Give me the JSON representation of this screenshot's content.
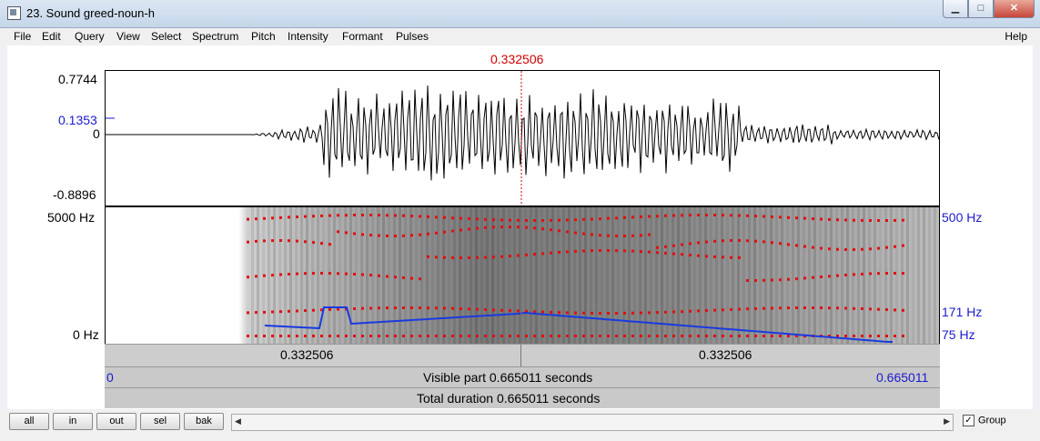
{
  "window": {
    "title": "23. Sound greed-noun-h"
  },
  "icons": {
    "minimize": "minimize-icon",
    "maximize": "maximize-icon",
    "close": "close-icon",
    "app": "app-icon"
  },
  "menu": [
    "File",
    "Edit",
    "Query",
    "View",
    "Select",
    "Spectrum",
    "Pitch",
    "Intensity",
    "Formant",
    "Pulses"
  ],
  "menu_help": "Help",
  "cursor": {
    "time": "0.332506"
  },
  "waveform": {
    "max": "0.7744",
    "marker": "0.1353",
    "zero": "0",
    "min": "-0.8896"
  },
  "spectrogram": {
    "top": "5000 Hz",
    "bottom": "0 Hz",
    "pitch_top": "500 Hz",
    "pitch_marker": "171 Hz",
    "pitch_bottom": "75 Hz"
  },
  "time_rows": {
    "left_segment": "0.332506",
    "right_segment": "0.332506",
    "start": "0",
    "end": "0.665011",
    "visible": "Visible part 0.665011 seconds",
    "total": "Total duration 0.665011 seconds"
  },
  "buttons": [
    "all",
    "in",
    "out",
    "sel",
    "bak"
  ],
  "group": {
    "label": "Group",
    "checked": true
  },
  "colors": {
    "cursor": "#d00000",
    "pitch": "#1a1ad0",
    "formant": "#e01010"
  }
}
